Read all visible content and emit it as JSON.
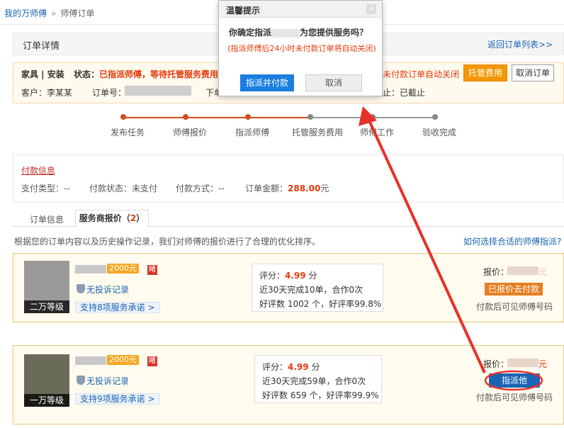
{
  "breadcrumb": {
    "home": "我的万师傅",
    "sep": "»",
    "current": "师傅订单"
  },
  "header": {
    "title": "订单详情",
    "back_link": "返回订单列表>>"
  },
  "order": {
    "category": "家具 | 安装",
    "status_label": "状态：",
    "status_value": "已指派师傅，等待托管服务费用",
    "warning": "未付款订单自动关闭",
    "pay_button": "托管费用",
    "cancel_button": "取消订单",
    "customer": "客户：李某某",
    "order_no_label": "订单号：",
    "order_time_label": "下单",
    "deadline": "止：已截止"
  },
  "steps": [
    {
      "label": "发布任务",
      "done": true
    },
    {
      "label": "师傅报价",
      "done": true
    },
    {
      "label": "指派师傅",
      "done": true
    },
    {
      "label": "托管服务费用",
      "done": false
    },
    {
      "label": "师傅工作",
      "done": false
    },
    {
      "label": "验收完成",
      "done": false
    }
  ],
  "payment": {
    "title": "付款信息",
    "pay_type": "支付类型：--",
    "pay_status": "付款状态：未支付",
    "pay_method": "付款方式：--",
    "amount_label": "订单金额：",
    "amount_value": "288.00",
    "amount_unit": "元"
  },
  "tabs": {
    "tab1": "订单信息",
    "tab2": "服务商报价（",
    "tab2_count": "2",
    "tab2_end": "）"
  },
  "intro": "根据您的订单内容以及历史操作记录，我们对师傅的报价进行了合理的优化排序。",
  "help_link": "如何选择合适的师傅指派?",
  "providers": [
    {
      "level": "二万等级",
      "price_badge": "2000元",
      "red_badge": "睹",
      "no_complaint": "无投诉记录",
      "promise": "支持8项服务承诺 >",
      "score_label": "评分：",
      "score": "4.99",
      "score_unit": " 分",
      "orders": "近30天完成10单，合作0次",
      "reviews": "好评数 1002 个，好评率99.8%",
      "quote_label": "报价：",
      "quote_unit": "元",
      "action": "已报价去付款",
      "note": "付款后可见师傅号码"
    },
    {
      "level": "一万等级",
      "price_badge": "2000元",
      "red_badge": "睹",
      "no_complaint": "无投诉记录",
      "promise": "支持9项服务承诺 >",
      "score_label": "评分：",
      "score": "4.99",
      "score_unit": " 分",
      "orders": "近30天完成59单，合作0次",
      "reviews": "好评数 659 个，好评率99.9%",
      "quote_label": "报价：",
      "quote_unit": "元",
      "action": "指派他",
      "note": "付款后可见师傅号码"
    }
  ],
  "modal": {
    "title": "温馨提示",
    "close": "×",
    "question_start": "你确定指派",
    "question_end": "为您提供服务吗？",
    "warning": "(指派师傅后24小时未付款订单将自动关闭)",
    "confirm": "指派并付款",
    "cancel": "取消"
  },
  "colors": {
    "accent": "#e5390b",
    "link": "#1a64b4",
    "orange": "#f39700",
    "annotation": "#e8302a"
  }
}
